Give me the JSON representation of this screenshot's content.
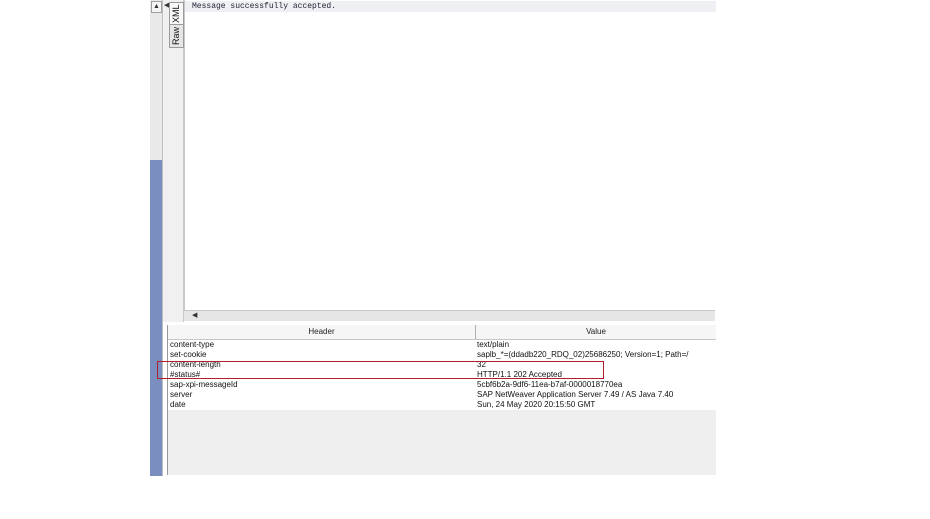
{
  "tabs": [
    {
      "label": "XML"
    },
    {
      "label": "Raw"
    }
  ],
  "message": {
    "text": "Message successfully accepted."
  },
  "table": {
    "columns": [
      "Header",
      "Value"
    ],
    "rows": [
      {
        "header": "content-type",
        "value": "text/plain"
      },
      {
        "header": "set-cookie",
        "value": "saplb_*=(ddadb220_RDQ_02)25686250; Version=1; Path=/"
      },
      {
        "header": "content-length",
        "value": "32"
      },
      {
        "header": "#status#",
        "value": "HTTP/1.1 202 Accepted"
      },
      {
        "header": "sap-xpi-messageId",
        "value": "5cbf6b2a-9df6-11ea-b7af-0000018770ea"
      },
      {
        "header": "server",
        "value": "SAP NetWeaver Application Server 7.49 / AS Java 7.40"
      },
      {
        "header": "date",
        "value": "Sun, 24 May 2020 20:15:50 GMT"
      }
    ]
  },
  "icons": {
    "scroll_up": "triangle-up-icon",
    "scroll_left": "triangle-left-icon"
  },
  "colors": {
    "highlight": "#b0202a",
    "scroll_track": "#7a8fbf"
  }
}
